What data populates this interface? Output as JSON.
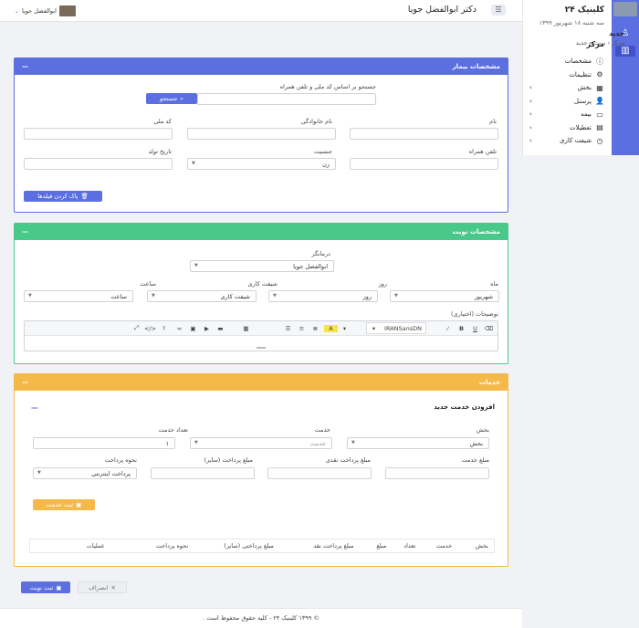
{
  "sidebar": {
    "clinic_name": "کلینیک ۲۴",
    "date": "سه شنبه ۱۸ شهریور ۱۳۹۹",
    "section": "مرکز",
    "items": [
      {
        "label": "مشخصات",
        "icon": "info-icon",
        "glyph": "ⓘ",
        "has_submenu": false
      },
      {
        "label": "تنظیمات",
        "icon": "gear-icon",
        "glyph": "⚙",
        "has_submenu": false
      },
      {
        "label": "بخش",
        "icon": "grid-icon",
        "glyph": "▦",
        "has_submenu": true
      },
      {
        "label": "پرسنل",
        "icon": "user-icon",
        "glyph": "👤",
        "has_submenu": true
      },
      {
        "label": "بیمه",
        "icon": "briefcase-icon",
        "glyph": "▭",
        "has_submenu": true
      },
      {
        "label": "تعطیلات",
        "icon": "calendar-icon",
        "glyph": "▤",
        "has_submenu": true
      },
      {
        "label": "شیفت کاری",
        "icon": "clock-icon",
        "glyph": "◷",
        "has_submenu": true
      }
    ]
  },
  "header": {
    "title": "دکتر ابوالفضل جویا",
    "user_name": "ابوالفضل جویا"
  },
  "page": {
    "title": "جدید",
    "breadcrumb": [
      "مرکز",
      "نوبت",
      "جدید"
    ]
  },
  "patient": {
    "header": "مشخصات بیمار",
    "search_label": "جستجو بر اساس کد ملی و تلفن همراه",
    "search_button": "جستجو",
    "first_name_label": "نام",
    "last_name_label": "نام خانوادگی",
    "national_code_label": "کد ملی",
    "mobile_label": "تلفن همراه",
    "gender_label": "جنسیت",
    "gender_value": "زن",
    "birth_date_label": "تاریخ تولد",
    "clear_button": "پاک کردن فیلدها"
  },
  "appointment": {
    "header": "مشخصات نوبت",
    "doctor_label": "درمانگر",
    "doctor_value": "ابوالفضل جویا",
    "month_label": "ماه",
    "month_value": "شهریور",
    "day_label": "روز",
    "day_value": "روز",
    "shift_label": "شیفت کاری",
    "shift_value": "شیفت کاری",
    "hour_label": "ساعت",
    "hour_value": "ساعت",
    "description_label": "توضیحات (اختیاری)",
    "editor_font": "IRANSansDN"
  },
  "services": {
    "header": "خدمات",
    "add_title": "افزودن خدمت جدید",
    "dept_label": "بخش",
    "dept_value": "بخش",
    "service_label": "خدمت",
    "service_value": "خدمت",
    "count_label": "تعداد خدمت",
    "count_value": "۱",
    "amount_label": "مبلغ خدمت",
    "cash_label": "مبلغ پرداخت نقدی",
    "other_label": "مبلغ پرداخت (سایر)",
    "method_label": "نحوه پرداخت",
    "method_value": "پرداخت اینترنتی",
    "submit_service": "ثبت خدمت",
    "table_headers": [
      "بخش",
      "خدمت",
      "تعداد",
      "مبلغ",
      "مبلغ پرداخت نقد",
      "مبلغ پرداختی (سایر)",
      "نحوه پرداخت",
      "عملیات"
    ]
  },
  "actions": {
    "submit": "ثبت نوبت",
    "cancel": "انصراف"
  },
  "footer": {
    "text": "© ۱۳۹۹ کلینیک ۲۴ - کلیه حقوق محفوظ است ."
  },
  "colors": {
    "primary": "#5b6fe0",
    "success": "#48c98a",
    "warning": "#f5b94a"
  }
}
